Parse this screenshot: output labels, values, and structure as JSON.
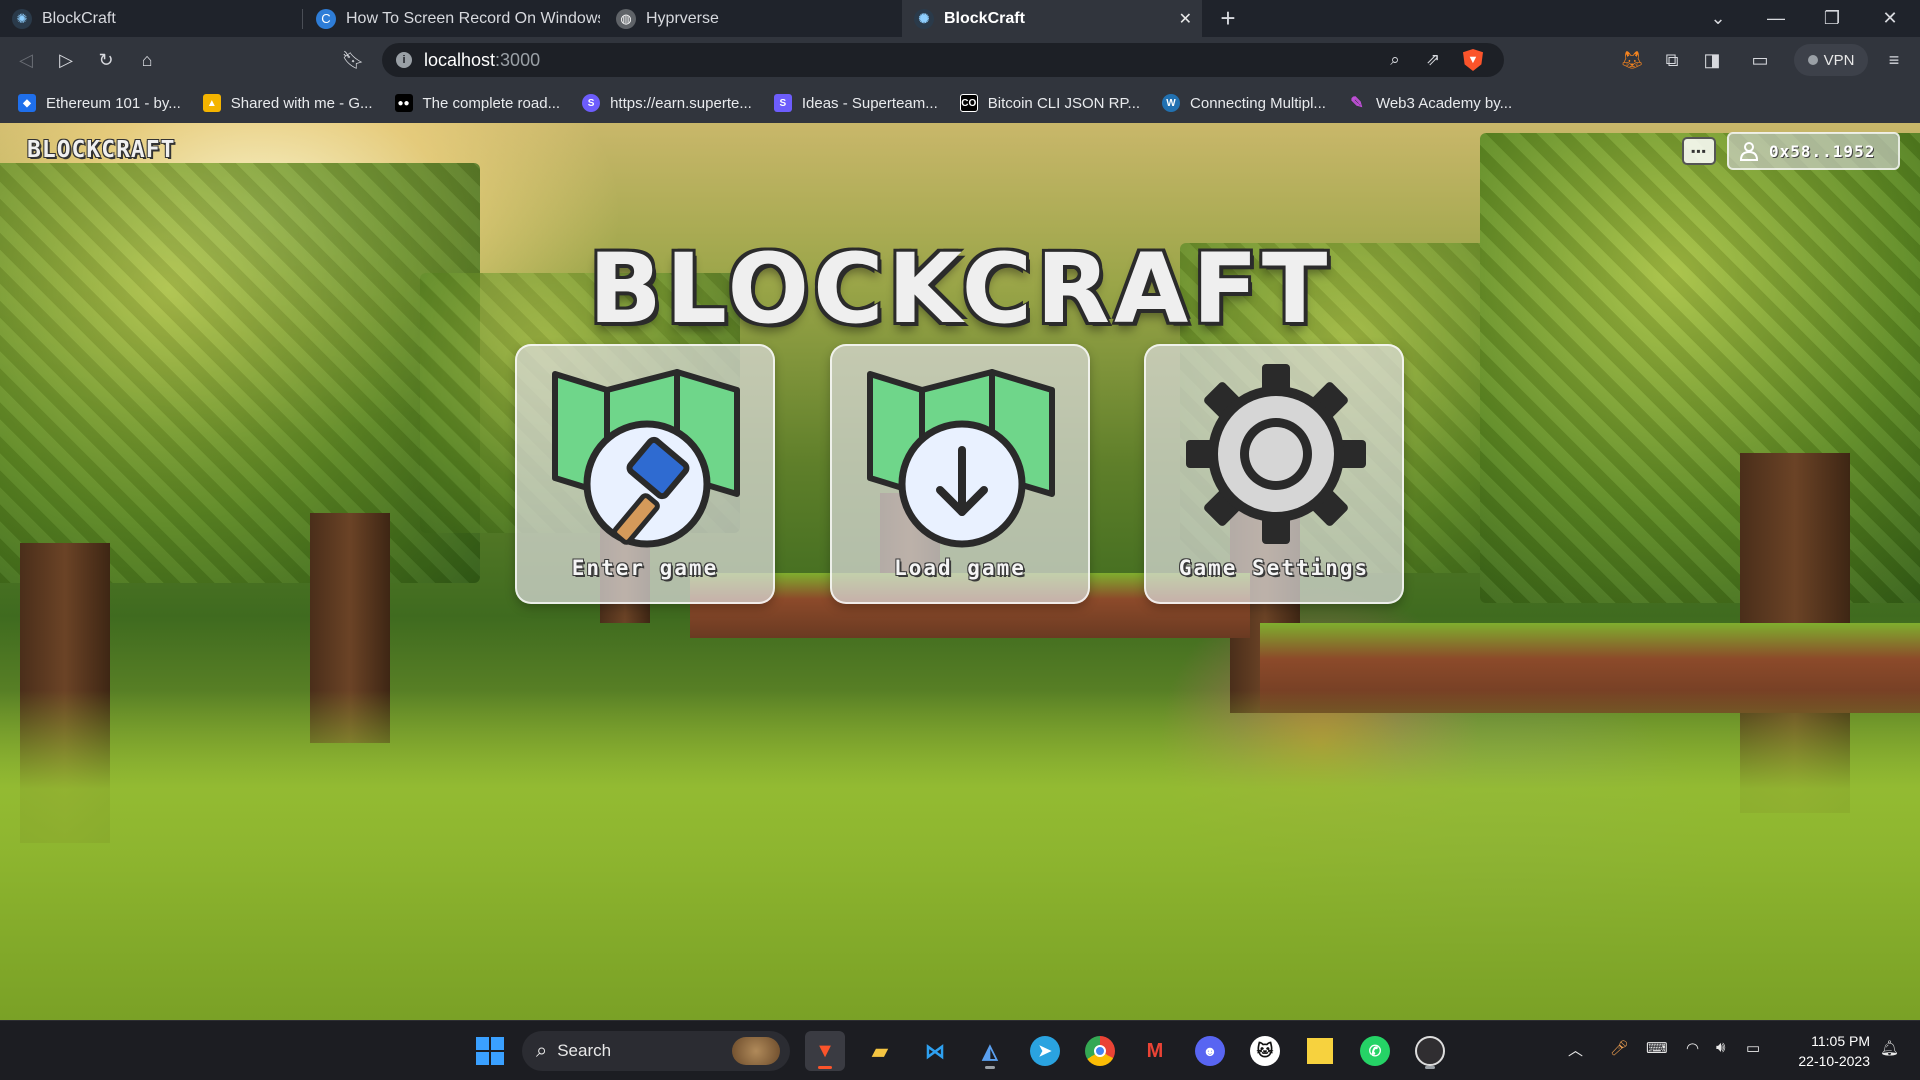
{
  "browser": {
    "tabs": [
      {
        "label": "BlockCraft",
        "active": false
      },
      {
        "label": "How To Screen Record On Windows: A",
        "active": false
      },
      {
        "label": "Hyprverse",
        "active": false
      },
      {
        "label": "BlockCraft",
        "active": true
      }
    ],
    "new_tab_symbol": "+",
    "close_symbol": "✕",
    "url_host": "localhost",
    "url_port": ":3000",
    "vpn_label": "VPN"
  },
  "bookmarks": [
    {
      "label": "Ethereum 101 - by...",
      "icon": "shield-icon",
      "color": "#1f6feb"
    },
    {
      "label": "Shared with me - G...",
      "icon": "drive-icon",
      "color": "#f4b400"
    },
    {
      "label": "The complete road...",
      "icon": "medium-icon",
      "color": "#000000"
    },
    {
      "label": "https://earn.superte...",
      "icon": "superteam-icon",
      "color": "#6d5dfc"
    },
    {
      "label": "Ideas - Superteam...",
      "icon": "superteam-icon",
      "color": "#6d5dfc"
    },
    {
      "label": "Bitcoin CLI JSON RP...",
      "icon": "co-icon",
      "color": "#000000"
    },
    {
      "label": "Connecting Multipl...",
      "icon": "wordpress-icon",
      "color": "#2271b1"
    },
    {
      "label": "Web3 Academy by...",
      "icon": "feather-icon",
      "color": "#c04fd8"
    }
  ],
  "game": {
    "logo": "BLOCKCRAFT",
    "title": "BLOCKCRAFT",
    "wallet_address": "0x58..1952",
    "chat_icon_text": "▪▪▪",
    "menu": [
      {
        "label": "Enter game",
        "icon": "map-hammer-icon"
      },
      {
        "label": "Load game",
        "icon": "map-download-icon"
      },
      {
        "label": "Game Settings",
        "icon": "gear-icon"
      }
    ],
    "colors": {
      "map_green": "#6fd68a",
      "outline": "#2a2a2a",
      "hammer_blue": "#2f6bd1",
      "handle": "#d59a5a"
    }
  },
  "taskbar": {
    "search_label": "Search",
    "time": "11:05 PM",
    "date": "22-10-2023",
    "apps": [
      "brave-icon",
      "file-explorer-icon",
      "vscode-icon",
      "app-icon",
      "telegram-icon",
      "chrome-icon",
      "gmail-icon",
      "discord-icon",
      "github-icon",
      "sticky-notes-icon",
      "whatsapp-icon",
      "obs-icon"
    ]
  }
}
